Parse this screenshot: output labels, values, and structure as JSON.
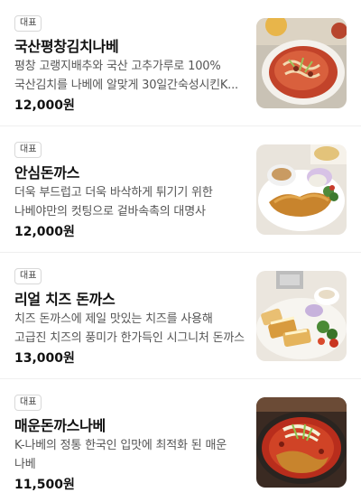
{
  "menu": {
    "items": [
      {
        "badge": "대표",
        "name": "국산평창김치나베",
        "description": "평창 고랭지배추와 국산 고추가루로 100% 국산김치를 나베에 알맞게 30일간숙성시킨K...",
        "price": "12,000원"
      },
      {
        "badge": "대표",
        "name": "안심돈까스",
        "description": "더욱 부드럽고 더욱 바삭하게 튀기기 위한 나베야만의 컷팅으로 겉바속촉의 대명사",
        "price": "12,000원"
      },
      {
        "badge": "대표",
        "name": "리얼 치즈 돈까스",
        "description": "치즈 돈까스에 제일 맛있는 치즈를 사용해 고급진 치즈의 풍미가 한가득인 시그니처 돈까스",
        "price": "13,000원"
      },
      {
        "badge": "대표",
        "name": "매운돈까스나베",
        "description": "K-나베의 정통 한국인 입맛에 최적화 된 매운 나베",
        "price": "11,500원"
      }
    ]
  }
}
